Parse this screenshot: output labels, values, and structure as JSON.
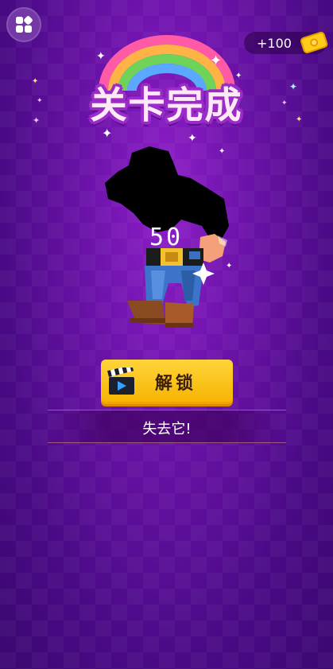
{
  "header": {
    "menu_icon": "grid-menu-icon",
    "coins": "+100",
    "coin_icon": "ticket-coin-icon"
  },
  "title": "关卡完成",
  "character": {
    "level_number": "50",
    "silhouette": true
  },
  "actions": {
    "unlock_label": "解锁",
    "unlock_icon": "clapperboard-icon",
    "lose_label": "失去它!"
  },
  "colors": {
    "background": "#6a12a8",
    "unlock_button": "#fcc21b",
    "title_outline": "#9b2cc8"
  }
}
